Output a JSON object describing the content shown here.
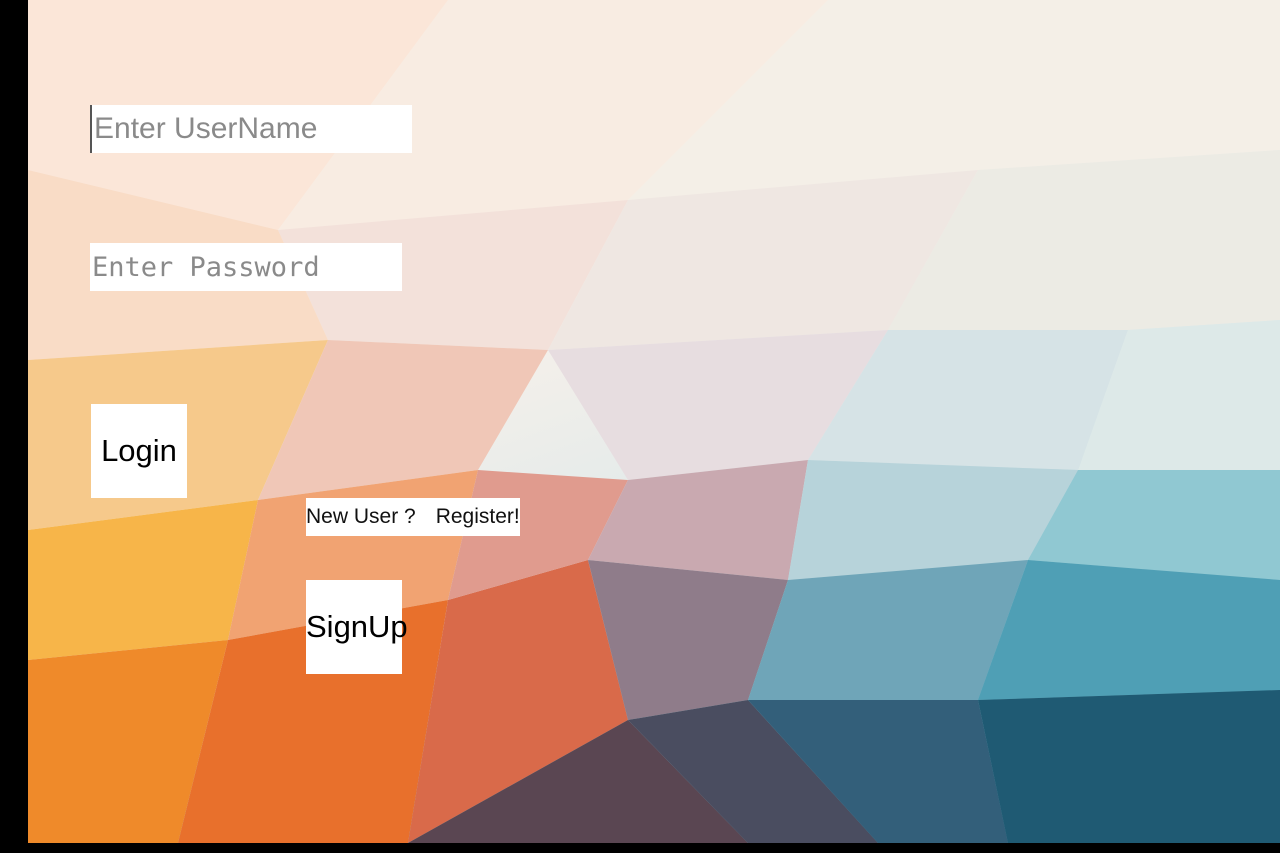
{
  "login_form": {
    "username_placeholder": "Enter UserName",
    "password_placeholder": "Enter Password",
    "login_label": "Login",
    "new_user_text": "New User ?",
    "register_text": "Register!",
    "signup_label": "SignUp"
  },
  "colors": {
    "field_background": "#ffffff",
    "placeholder_text": "#8a8a8a"
  }
}
